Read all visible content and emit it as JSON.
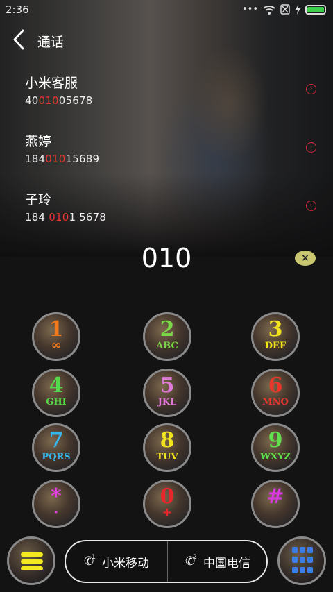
{
  "status_bar": {
    "time": "2:36",
    "icons": [
      "dots-icon",
      "wifi-icon",
      "sim-blocked-icon",
      "charging-icon",
      "battery-icon"
    ]
  },
  "header": {
    "title": "通话"
  },
  "contacts": [
    {
      "name": "小米客服",
      "number_pre": "40",
      "number_match": "010",
      "number_post": "05678"
    },
    {
      "name": "燕婷",
      "number_pre": "184",
      "number_match": "010",
      "number_post": "15689"
    },
    {
      "name": "子玲",
      "number_pre": "184 ",
      "number_match": "010",
      "number_post": "1 5678"
    }
  ],
  "dialed_number": "010",
  "keypad": [
    {
      "digit": "1",
      "sub": "∞",
      "color": "#f07a1e"
    },
    {
      "digit": "2",
      "sub": "ABC",
      "color": "#7cd84a"
    },
    {
      "digit": "3",
      "sub": "DEF",
      "color": "#f2e51c"
    },
    {
      "digit": "4",
      "sub": "GHI",
      "color": "#55d94a"
    },
    {
      "digit": "5",
      "sub": "JKL",
      "color": "#e07ad8"
    },
    {
      "digit": "6",
      "sub": "MNO",
      "color": "#e8372b"
    },
    {
      "digit": "7",
      "sub": "PQRS",
      "color": "#36b7ec"
    },
    {
      "digit": "8",
      "sub": "TUV",
      "color": "#f2e51c"
    },
    {
      "digit": "9",
      "sub": "WXYZ",
      "color": "#5fe04c"
    },
    {
      "digit": "*",
      "sub": "·",
      "color": "#e040e0"
    },
    {
      "digit": "0",
      "sub": "+",
      "color": "#e8262b"
    },
    {
      "digit": "#",
      "sub": "",
      "color": "#d83ae0"
    }
  ],
  "sim": {
    "sim1_label": "小米移动",
    "sim2_label": "中国电信",
    "sim1_index": "1",
    "sim2_index": "2"
  },
  "colors": {
    "highlight": "#e5372b",
    "menu_icon": "#f2ea1f",
    "keypad_icon": "#3a7fe8",
    "battery": "#3ed04a"
  }
}
